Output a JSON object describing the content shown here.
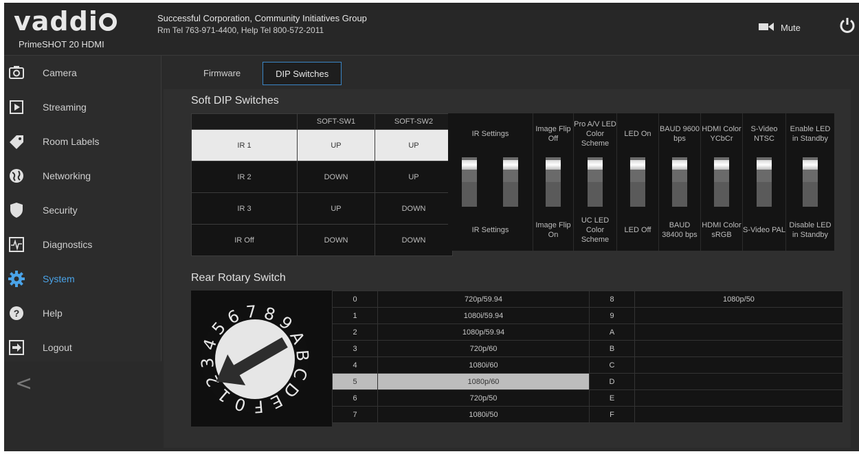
{
  "header": {
    "logo_text": "vaddi",
    "model": "PrimeSHOT 20 HDMI",
    "company": "Successful Corporation, Community Initiatives Group",
    "phones": "Rm Tel 763-971-4400, Help Tel 800-572-2011",
    "mute_label": "Mute"
  },
  "sidebar": {
    "items": [
      {
        "label": "Camera",
        "icon": "camera-icon"
      },
      {
        "label": "Streaming",
        "icon": "play-icon"
      },
      {
        "label": "Room Labels",
        "icon": "tag-icon"
      },
      {
        "label": "Networking",
        "icon": "globe-icon"
      },
      {
        "label": "Security",
        "icon": "shield-icon"
      },
      {
        "label": "Diagnostics",
        "icon": "pulse-icon"
      },
      {
        "label": "System",
        "icon": "gear-icon"
      },
      {
        "label": "Help",
        "icon": "help-icon"
      },
      {
        "label": "Logout",
        "icon": "logout-icon"
      }
    ],
    "active": "System",
    "collapse_glyph": "<"
  },
  "tabs": [
    {
      "label": "Firmware"
    },
    {
      "label": "DIP Switches"
    }
  ],
  "soft_dip": {
    "title": "Soft DIP Switches",
    "headers": [
      "",
      "SOFT-SW1",
      "SOFT-SW2"
    ],
    "rows": [
      [
        "IR 1",
        "UP",
        "UP"
      ],
      [
        "IR 2",
        "DOWN",
        "UP"
      ],
      [
        "IR 3",
        "UP",
        "DOWN"
      ],
      [
        "IR Off",
        "DOWN",
        "DOWN"
      ]
    ],
    "switches": [
      {
        "top": "IR Settings",
        "bottom": "IR Settings"
      },
      {
        "top": "Image Flip Off",
        "bottom": "Image Flip On"
      },
      {
        "top": "Pro A/V LED Color Scheme",
        "bottom": "UC LED Color Scheme"
      },
      {
        "top": "LED On",
        "bottom": "LED Off"
      },
      {
        "top": "BAUD 9600 bps",
        "bottom": "BAUD 38400 bps"
      },
      {
        "top": "HDMI Color YCbCr",
        "bottom": "HDMI Color sRGB"
      },
      {
        "top": "S-Video NTSC",
        "bottom": "S-Video PAL"
      },
      {
        "top": "Enable LED in Standby",
        "bottom": "Disable LED in Standby"
      }
    ]
  },
  "rotary": {
    "title": "Rear Rotary Switch",
    "dial_digits": [
      "8",
      "9",
      "A",
      "B",
      "C",
      "D",
      "E",
      "F",
      "0",
      "1",
      "2",
      "3",
      "4",
      "5",
      "6",
      "7"
    ],
    "selected": "5",
    "left": [
      {
        "pos": "0",
        "mode": "720p/59.94"
      },
      {
        "pos": "1",
        "mode": "1080i/59.94"
      },
      {
        "pos": "2",
        "mode": "1080p/59.94"
      },
      {
        "pos": "3",
        "mode": "720p/60"
      },
      {
        "pos": "4",
        "mode": "1080i/60"
      },
      {
        "pos": "5",
        "mode": "1080p/60"
      },
      {
        "pos": "6",
        "mode": "720p/50"
      },
      {
        "pos": "7",
        "mode": "1080i/50"
      }
    ],
    "right": [
      {
        "pos": "8",
        "mode": "1080p/50"
      },
      {
        "pos": "9",
        "mode": ""
      },
      {
        "pos": "A",
        "mode": ""
      },
      {
        "pos": "B",
        "mode": ""
      },
      {
        "pos": "C",
        "mode": ""
      },
      {
        "pos": "D",
        "mode": ""
      },
      {
        "pos": "E",
        "mode": ""
      },
      {
        "pos": "F",
        "mode": ""
      }
    ]
  },
  "colors": {
    "accent": "#4aa3e8",
    "background": "#2a2a2a"
  }
}
